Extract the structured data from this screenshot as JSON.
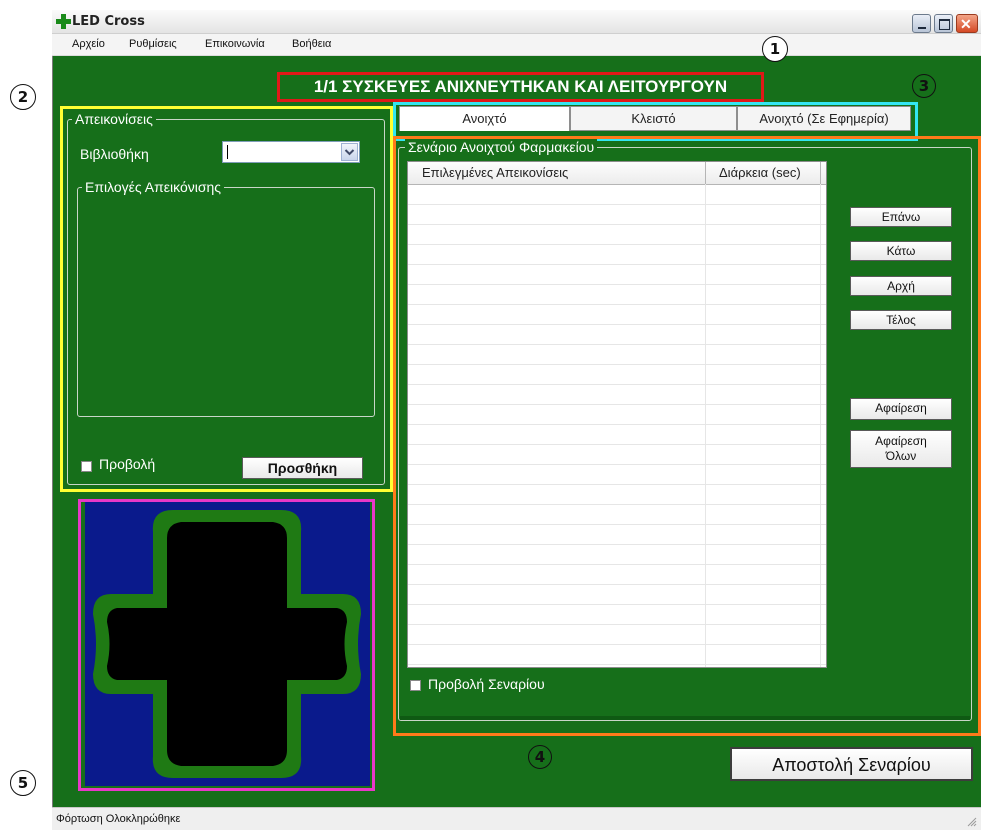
{
  "window": {
    "title": "LED Cross",
    "status": "Φόρτωση Ολοκληρώθηκε"
  },
  "menu": [
    "Αρχείο",
    "Ρυθμίσεις",
    "Επικοινωνία",
    "Βοήθεια"
  ],
  "banner": "1/1 ΣΥΣΚΕΥΕΣ ΑΝΙΧΝΕΥΤΗΚΑΝ ΚΑΙ ΛΕΙΤΟΥΡΓΟΥΝ",
  "left_panel": {
    "group_title": "Απεικονίσεις",
    "library_label": "Βιβλιοθήκη",
    "library_value": "",
    "options_title": "Επιλογές Απεικόνισης",
    "preview_label": "Προβολή",
    "add_button": "Προσθήκη"
  },
  "tabs": [
    "Ανοιχτό",
    "Κλειστό",
    "Ανοιχτό (Σε Εφημερία)"
  ],
  "scenario": {
    "group_title": "Σενάριο Ανοιχτού Φαρμακείου",
    "columns": [
      "Επιλεγμένες Απεικονίσεις",
      "Διάρκεια (sec)"
    ],
    "buttons": {
      "up": "Επάνω",
      "down": "Κάτω",
      "start": "Αρχή",
      "end": "Τέλος",
      "remove": "Αφαίρεση",
      "remove_all_1": "Αφαίρεση",
      "remove_all_2": "Όλων"
    },
    "preview_label": "Προβολή Σεναρίου"
  },
  "send_button": "Αποστολή Σεναρίου",
  "callouts": [
    "1",
    "2",
    "3",
    "4",
    "5"
  ],
  "colors": {
    "window_bg": "#166f1a",
    "highlight_banner": "#e01818",
    "highlight_left": "#ffff33",
    "highlight_tabs": "#33e6f2",
    "highlight_scenario": "#ff7a1a",
    "highlight_preview": "#e838c8",
    "preview_bg": "#0a1a8c",
    "cross_border": "#1f7a14"
  },
  "icons": [
    "green-cross-icon",
    "minimize-icon",
    "maximize-icon",
    "close-icon",
    "chevron-down-icon"
  ]
}
